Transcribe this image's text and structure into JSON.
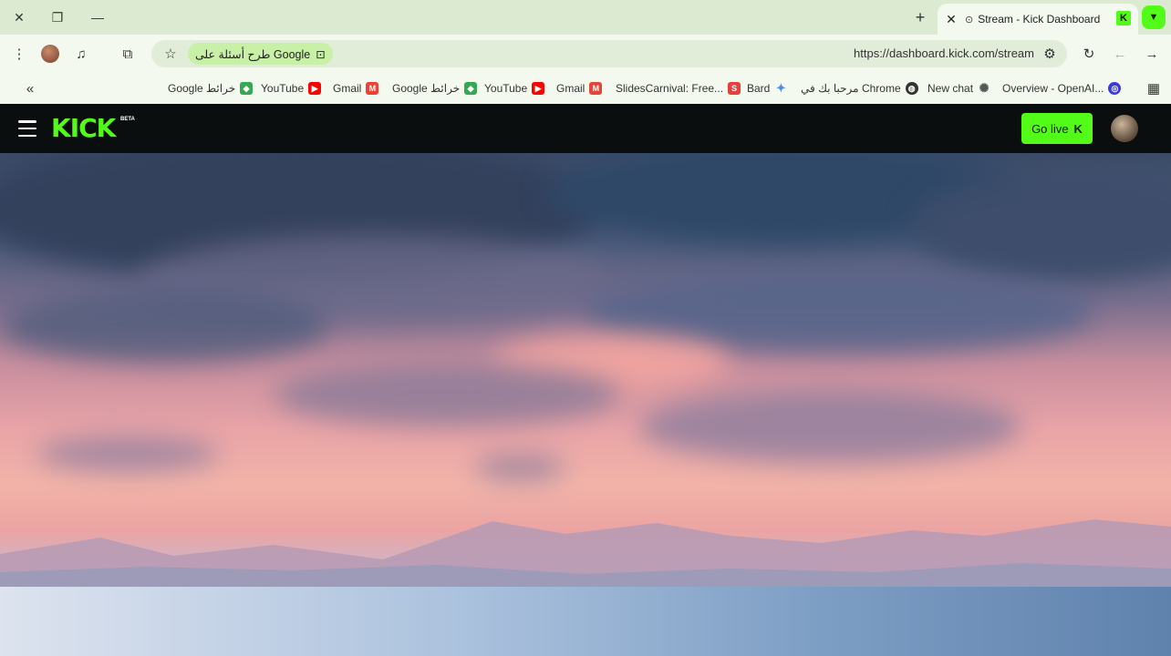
{
  "browser": {
    "tab": {
      "title": "Stream - Kick Dashboard"
    },
    "omnibox": {
      "ai_chip_label": "طرح أسئلة على Google",
      "url": "https://dashboard.kick.com/stream"
    },
    "bookmarks": [
      {
        "label": "Google خرائط",
        "icon": "maps-icon",
        "color": "#34a853"
      },
      {
        "label": "YouTube",
        "icon": "youtube-icon",
        "color": "#ff0000"
      },
      {
        "label": "Gmail",
        "icon": "gmail-icon",
        "color": "#ea4335"
      },
      {
        "label": "Google خرائط",
        "icon": "maps-icon",
        "color": "#34a853"
      },
      {
        "label": "YouTube",
        "icon": "youtube-icon",
        "color": "#ff0000"
      },
      {
        "label": "Gmail",
        "icon": "gmail-icon",
        "color": "#ea4335"
      },
      {
        "label": "SlidesCarnival: Free...",
        "icon": "slidescarnival-icon",
        "color": "#e3413d"
      },
      {
        "label": "Bard",
        "icon": "bard-icon",
        "color": "#4b8bf5"
      },
      {
        "label": "مرحبا بك في Chrome",
        "icon": "chrome-globe-icon",
        "color": "#333333"
      },
      {
        "label": "New chat",
        "icon": "openai-icon",
        "color": "#555555"
      },
      {
        "label": "Overview - OpenAI...",
        "icon": "openai-overview-icon",
        "color": "#3b3bdc"
      }
    ]
  },
  "kick": {
    "logo_text": "KICK",
    "beta_label": "BETA",
    "go_live_label": "Go live",
    "accent_color": "#53fc18"
  }
}
